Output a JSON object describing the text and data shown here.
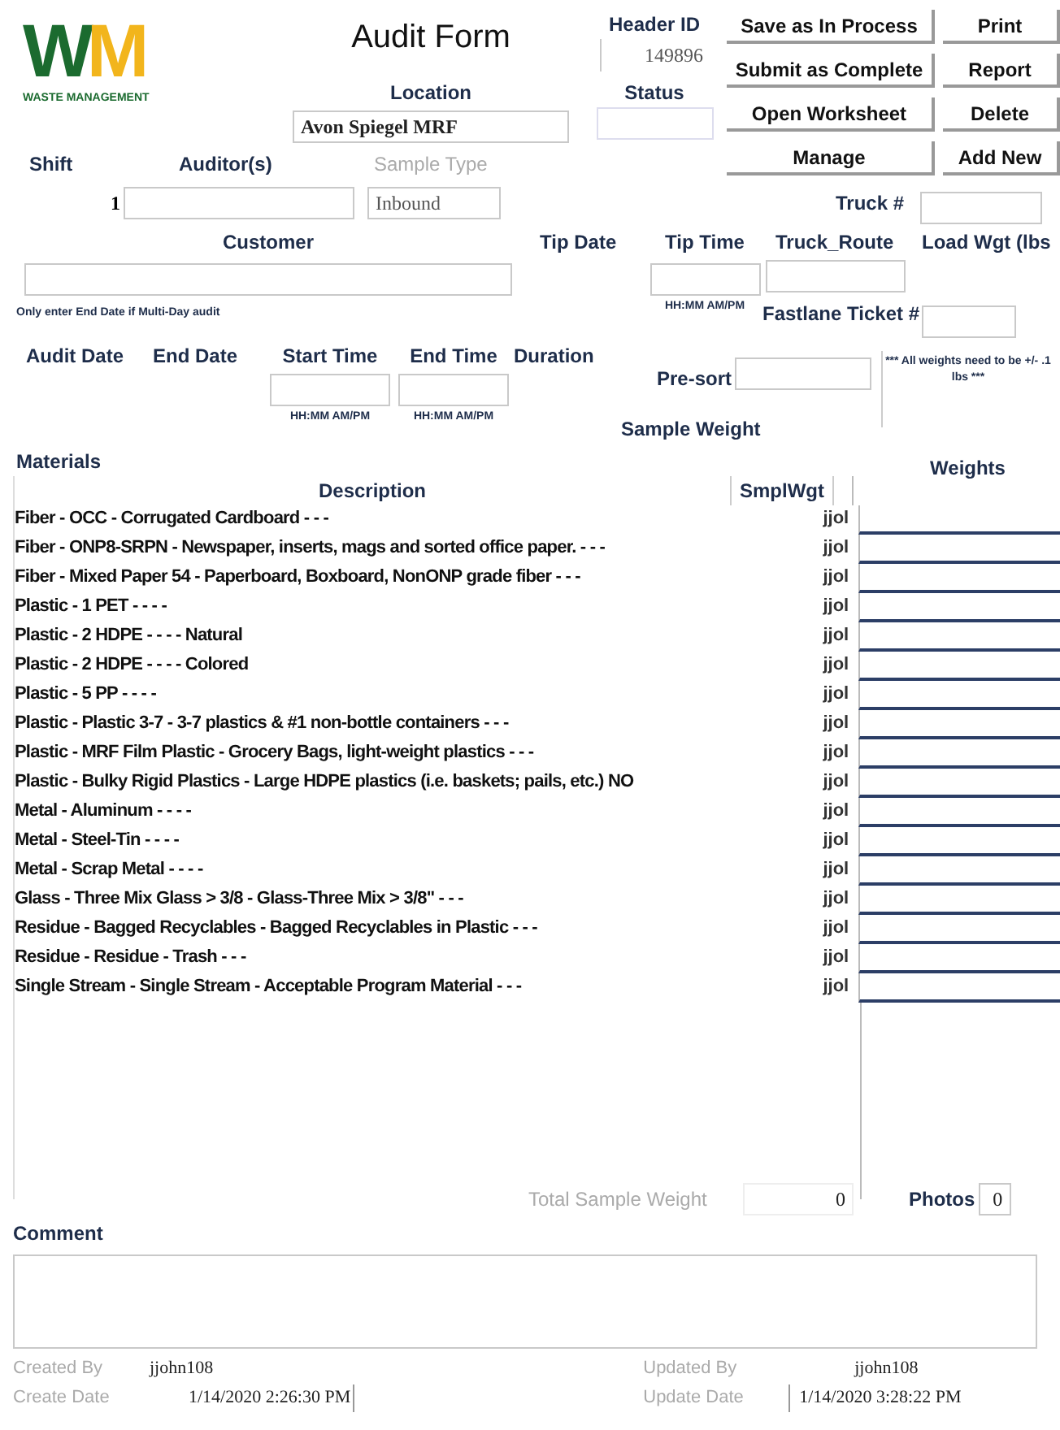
{
  "logo": {
    "mark": [
      "W",
      "M"
    ],
    "wordmark": "WASTE MANAGEMENT"
  },
  "title": "Audit Form",
  "header_id": {
    "label": "Header ID",
    "value": "149896"
  },
  "location": {
    "label": "Location",
    "value": "Avon Spiegel MRF"
  },
  "status": {
    "label": "Status",
    "disabled": true
  },
  "buttons": [
    "Save as In Process",
    "Print",
    "Submit as Complete",
    "Report",
    "Open Worksheet",
    "Delete",
    "Manage",
    "Add New"
  ],
  "shift": {
    "label": "Shift",
    "value": "1"
  },
  "auditors": {
    "label": "Auditor(s)"
  },
  "sample_type": {
    "label": "Sample Type",
    "value": "Inbound",
    "disabled": true
  },
  "truck": {
    "label": "Truck #"
  },
  "customer": {
    "label": "Customer"
  },
  "tip_date": {
    "label": "Tip Date"
  },
  "tip_time": {
    "label": "Tip Time",
    "hint": "HH:MM AM/PM"
  },
  "truck_route": {
    "label": "Truck_Route"
  },
  "load_wgt": {
    "label": "Load Wgt (lbs"
  },
  "end_date_note": "Only enter End Date if Multi-Day audit",
  "fastlane_ticket": {
    "label": "Fastlane Ticket #"
  },
  "audit_date": {
    "label": "Audit Date"
  },
  "end_date": {
    "label": "End Date"
  },
  "start_time": {
    "label": "Start Time",
    "hint": "HH:MM AM/PM"
  },
  "end_time": {
    "label": "End Time",
    "hint": "HH:MM AM/PM"
  },
  "duration": {
    "label": "Duration"
  },
  "presort": {
    "label_1": "Pre-sort",
    "label_2": "Sample Weight"
  },
  "weights_note": "*** All weights need to be +/- .1 lbs ***",
  "materials": {
    "label": "Materials",
    "columns": [
      "Description",
      "SmplWgt"
    ],
    "weights_label": "Weights",
    "rows": [
      {
        "description": "Fiber - OCC - Corrugated Cardboard - - -",
        "column_3": "jjol"
      },
      {
        "description": "Fiber - ONP8-SRPN - Newspaper, inserts, mags and sorted office paper. - - -",
        "column_3": "jjol"
      },
      {
        "description": "Fiber - Mixed Paper 54 - Paperboard, Boxboard, NonONP grade fiber - - -",
        "column_3": "jjol"
      },
      {
        "description": "Plastic - 1 PET - - - -",
        "column_3": "jjol"
      },
      {
        "description": "Plastic - 2 HDPE - - - - Natural",
        "column_3": "jjol"
      },
      {
        "description": "Plastic - 2 HDPE - - - - Colored",
        "column_3": "jjol"
      },
      {
        "description": "Plastic - 5 PP - - - -",
        "column_3": "jjol"
      },
      {
        "description": "Plastic - Plastic 3-7 - 3-7 plastics & #1 non-bottle containers - - -",
        "column_3": "jjol"
      },
      {
        "description": "Plastic - MRF Film Plastic - Grocery Bags, light-weight plastics - - -",
        "column_3": "jjol"
      },
      {
        "description": "Plastic - Bulky Rigid Plastics - Large HDPE plastics (i.e. baskets; pails, etc.) NO",
        "column_3": "jjol"
      },
      {
        "description": "Metal - Aluminum - - - -",
        "column_3": "jjol"
      },
      {
        "description": "Metal - Steel-Tin - - - -",
        "column_3": "jjol"
      },
      {
        "description": "Metal - Scrap Metal - - - -",
        "column_3": "jjol"
      },
      {
        "description": "Glass - Three Mix Glass > 3/8 - Glass-Three Mix > 3/8\" - - -",
        "column_3": "jjol"
      },
      {
        "description": "Residue - Bagged Recyclables - Bagged Recyclables in Plastic - - -",
        "column_3": "jjol"
      },
      {
        "description": "Residue - Residue - Trash - - -",
        "column_3": "jjol"
      },
      {
        "description": "Single Stream - Single Stream - Acceptable Program Material - - -",
        "column_3": "jjol"
      }
    ]
  },
  "total_sample_weight": {
    "label": "Total Sample Weight",
    "value": "0"
  },
  "photos": {
    "label": "Photos",
    "value": "0"
  },
  "comment": {
    "label": "Comment"
  },
  "created_by": {
    "label": "Created By",
    "value": "jjohn108"
  },
  "create_date": {
    "label": "Create Date",
    "value": "1/14/2020 2:26:30 PM"
  },
  "updated_by": {
    "label": "Updated By",
    "value": "jjohn108"
  },
  "update_date": {
    "label": "Update Date",
    "value": "1/14/2020 3:28:22 PM"
  }
}
